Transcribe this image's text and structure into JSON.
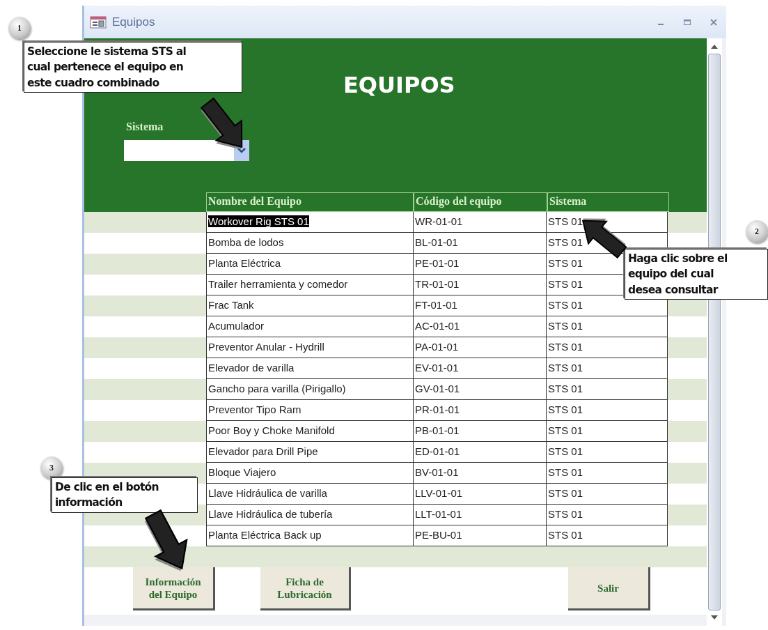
{
  "window": {
    "title": "Equipos"
  },
  "header": {
    "title": "EQUIPOS",
    "filter": {
      "label": "Sistema"
    }
  },
  "table": {
    "columns": [
      "Nombre del Equipo",
      "Código del equipo",
      "Sistema"
    ],
    "rows": [
      {
        "cells": [
          "Workover Rig STS 01",
          "WR-01-01",
          "STS 01"
        ],
        "selected": true
      },
      {
        "cells": [
          "Bomba de lodos",
          "BL-01-01",
          "STS 01"
        ],
        "selected": false
      },
      {
        "cells": [
          "Planta Eléctrica",
          "PE-01-01",
          "STS 01"
        ],
        "selected": false
      },
      {
        "cells": [
          "Trailer herramienta y comedor",
          "TR-01-01",
          "STS 01"
        ],
        "selected": false
      },
      {
        "cells": [
          "Frac Tank",
          "FT-01-01",
          "STS 01"
        ],
        "selected": false
      },
      {
        "cells": [
          "Acumulador",
          "AC-01-01",
          "STS 01"
        ],
        "selected": false
      },
      {
        "cells": [
          "Preventor Anular - Hydrill",
          "PA-01-01",
          "STS 01"
        ],
        "selected": false
      },
      {
        "cells": [
          "Elevador de varilla",
          "EV-01-01",
          "STS 01"
        ],
        "selected": false
      },
      {
        "cells": [
          "Gancho para varilla (Pirigallo)",
          "GV-01-01",
          "STS 01"
        ],
        "selected": false
      },
      {
        "cells": [
          "Preventor Tipo Ram",
          "PR-01-01",
          "STS 01"
        ],
        "selected": false
      },
      {
        "cells": [
          "Poor Boy y Choke Manifold",
          "PB-01-01",
          "STS 01"
        ],
        "selected": false
      },
      {
        "cells": [
          "Elevador para Drill Pipe",
          "ED-01-01",
          "STS 01"
        ],
        "selected": false
      },
      {
        "cells": [
          "Bloque Viajero",
          "BV-01-01",
          "STS 01"
        ],
        "selected": false
      },
      {
        "cells": [
          "Llave Hidráulica de varilla",
          "LLV-01-01",
          "STS 01"
        ],
        "selected": false
      },
      {
        "cells": [
          "Llave Hidráulica de tubería",
          "LLT-01-01",
          "STS 01"
        ],
        "selected": false
      },
      {
        "cells": [
          "Planta Eléctrica Back up",
          "PE-BU-01",
          "STS 01"
        ],
        "selected": false
      }
    ]
  },
  "buttons": [
    "Información\ndel Equipo",
    "Ficha de\nLubricación",
    "Salir"
  ],
  "callouts": [
    {
      "number": "1",
      "text": "Seleccione le sistema STS al\ncual pertenece el equipo en\neste cuadro combinado"
    },
    {
      "number": "2",
      "text": "Haga clic sobre el\nequipo del  cual\ndesea consultar"
    },
    {
      "number": "3",
      "text": "De clic en el botón\ninformación"
    }
  ]
}
